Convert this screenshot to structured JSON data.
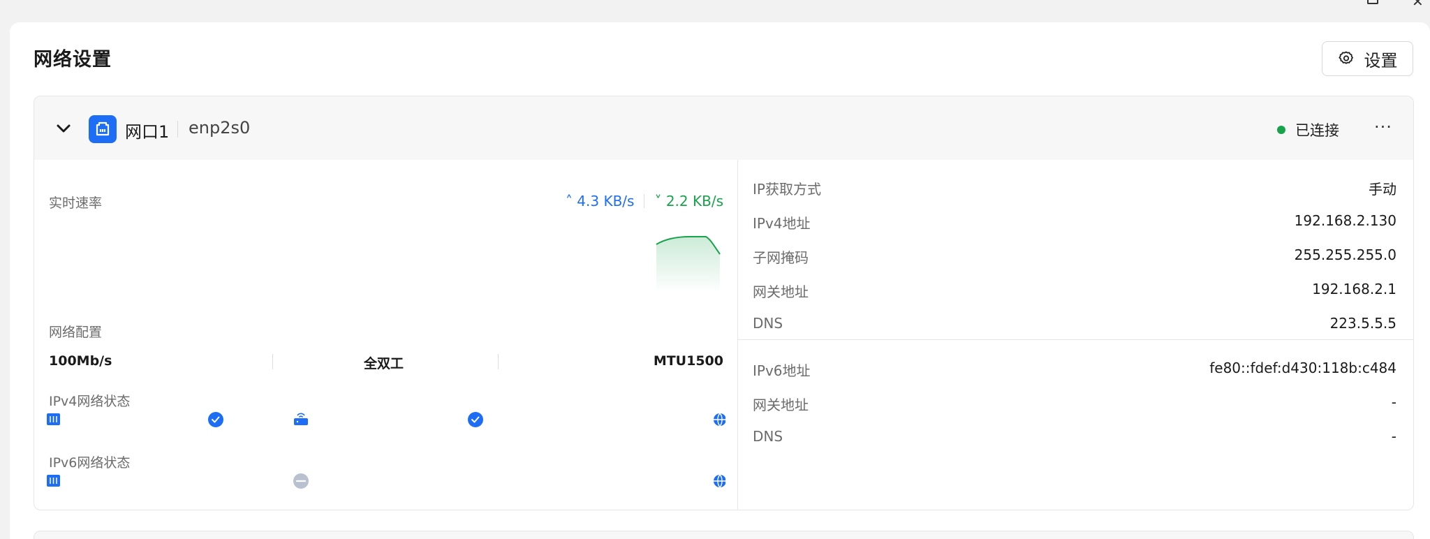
{
  "page": {
    "title": "网络设置",
    "settings_label": "设置"
  },
  "interface": {
    "name": "网口1",
    "device": "enp2s0",
    "status": "已连接",
    "colors": {
      "accent": "#1e6ef5",
      "connected": "#16a34a"
    }
  },
  "realtime": {
    "label": "实时速率",
    "upload": "4.3 KB/s",
    "download": "2.2 KB/s"
  },
  "config": {
    "label": "网络配置",
    "speed": "100Mb/s",
    "duplex": "全双工",
    "mtu": "MTU1500"
  },
  "ipv4_status": {
    "label": "IPv4网络状态"
  },
  "ipv6_status": {
    "label": "IPv6网络状态"
  },
  "ipv4": [
    {
      "key": "IP获取方式",
      "value": "手动"
    },
    {
      "key": "IPv4地址",
      "value": "192.168.2.130"
    },
    {
      "key": "子网掩码",
      "value": "255.255.255.0"
    },
    {
      "key": "网关地址",
      "value": "192.168.2.1"
    },
    {
      "key": "DNS",
      "value": "223.5.5.5"
    }
  ],
  "ipv6": [
    {
      "key": "IPv6地址",
      "value": "fe80::fdef:d430:118b:c484"
    },
    {
      "key": "网关地址",
      "value": "-"
    },
    {
      "key": "DNS",
      "value": "-"
    }
  ]
}
